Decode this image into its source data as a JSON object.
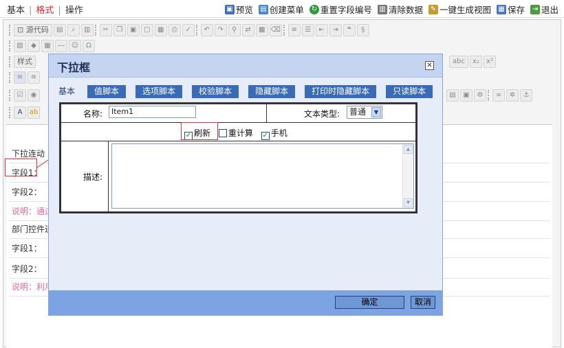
{
  "menu": {
    "items": [
      "基本",
      "格式",
      "操作"
    ],
    "active": 1
  },
  "actions": [
    {
      "label": "预览",
      "icon": "preview-icon",
      "color": "#3b6fc4"
    },
    {
      "label": "创建菜单",
      "icon": "create-menu-icon",
      "color": "#4a86d1"
    },
    {
      "label": "重置字段编号",
      "icon": "reset-number-icon",
      "color": "#2e9b3a"
    },
    {
      "label": "清除数据",
      "icon": "trash-icon",
      "color": "#777777"
    },
    {
      "label": "一键生成视图",
      "icon": "generate-view-icon",
      "color": "#c69a2b"
    },
    {
      "label": "保存",
      "icon": "save-icon",
      "color": "#4a76c4"
    },
    {
      "label": "退出",
      "icon": "exit-icon",
      "color": "#4e9a3e"
    }
  ],
  "toolbar": {
    "source_label": "源代码",
    "style_label": "样式",
    "superscript": "x²",
    "subscript": "x₂",
    "strike": "abc",
    "omega": "Ω"
  },
  "content_rows": [
    {
      "text": "下拉连动",
      "pink": false
    },
    {
      "text": "字段1：",
      "pink": false
    },
    {
      "text": "字段2：",
      "pink": false
    },
    {
      "text": "说明：通过",
      "pink": true
    },
    {
      "text": "部门控件连",
      "pink": false
    },
    {
      "text": "字段1：",
      "pink": false
    },
    {
      "text": "字段2：",
      "pink": false
    },
    {
      "text": "说明：利用",
      "pink": true
    }
  ],
  "dialog": {
    "title": "下拉框",
    "close_symbol": "✕",
    "tabs": [
      "基本",
      "值脚本",
      "选项脚本",
      "校验脚本",
      "隐藏脚本",
      "打印时隐藏脚本",
      "只读脚本"
    ],
    "active_tab": 0,
    "name_label": "名称:",
    "name_value": "Item1",
    "text_type_label": "文本类型:",
    "text_type_value": "普通",
    "checkboxes": [
      {
        "label": "刷新",
        "checked": true
      },
      {
        "label": "重计算",
        "checked": false
      },
      {
        "label": "手机",
        "checked": true
      }
    ],
    "desc_label": "描述:",
    "desc_value": "",
    "ok_label": "确定",
    "cancel_label": "取消"
  },
  "colors": {
    "accent_tab": "#3a6bb8",
    "dialog_header": "#c5d4f1",
    "dialog_footer": "#7da4e2",
    "annotation_red": "#e23030",
    "note_pink": "#e86aa3"
  }
}
